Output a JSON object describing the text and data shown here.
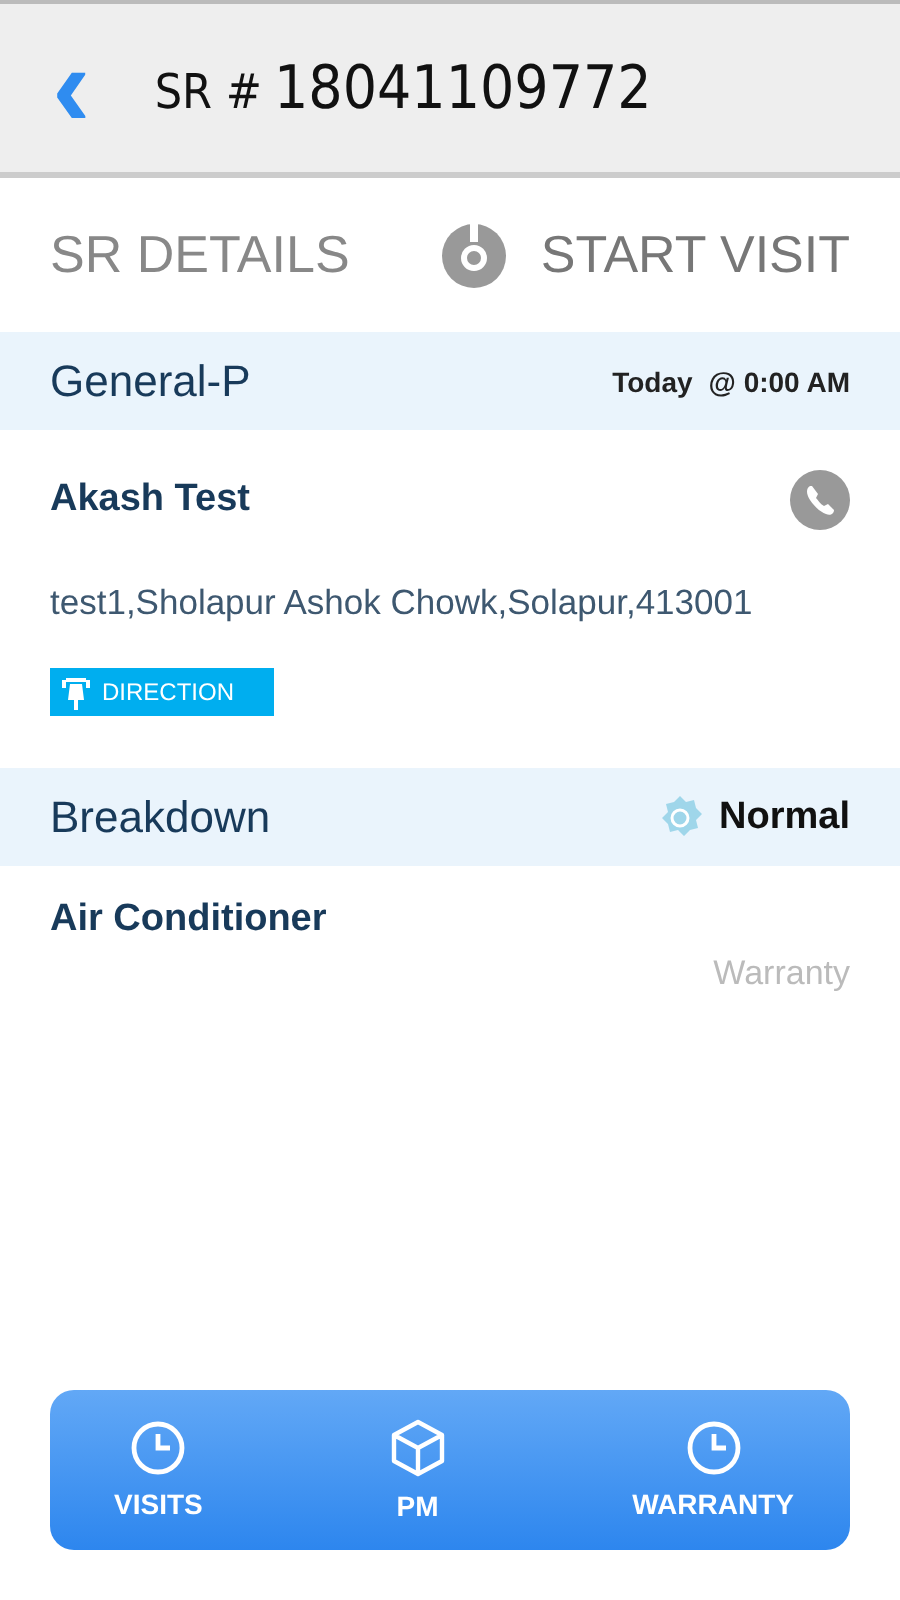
{
  "header": {
    "back": "‹",
    "prefix": "SR #",
    "number": "18041109772"
  },
  "section": {
    "title": "SR DETAILS",
    "action": "START VISIT"
  },
  "visit": {
    "type": "General-P",
    "day": "Today",
    "time": "@ 0:00 AM"
  },
  "customer": {
    "name": "Akash Test",
    "address": "test1,Sholapur Ashok Chowk,Solapur,413001",
    "direction": "DIRECTION"
  },
  "issue": {
    "type": "Breakdown",
    "priority": "Normal"
  },
  "product": {
    "name": "Air Conditioner",
    "coverage": "Warranty"
  },
  "nav": [
    {
      "label": "VISITS",
      "kind": "clock"
    },
    {
      "label": "PM",
      "kind": "box"
    },
    {
      "label": "WARRANTY",
      "kind": "clock"
    }
  ]
}
